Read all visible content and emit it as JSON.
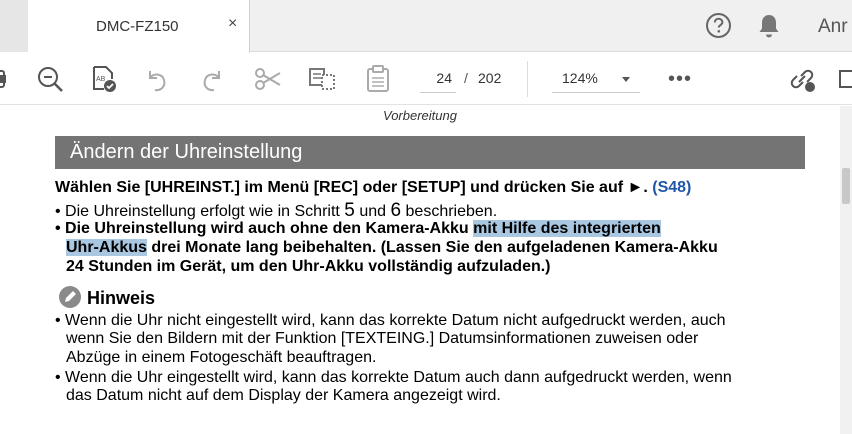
{
  "tab": {
    "title": "DMC-FZ150",
    "close": "×"
  },
  "header": {
    "user": "Anr"
  },
  "toolbar": {
    "page_current": "24",
    "page_sep": "/",
    "page_total": "202",
    "zoom": "124%",
    "more": "•••"
  },
  "doc": {
    "section_label": "Vorbereitung",
    "heading": "Ändern der Uhreinstellung",
    "intro": "Wählen Sie [UHREINST.] im Menü [REC] oder [SETUP] und drücken Sie auf ►.",
    "intro_ref": "(S48)",
    "bullets": {
      "b1_a": "Die Uhreinstellung erfolgt wie in Schritt",
      "b1_n1": "5",
      "b1_and": "und",
      "b1_n2": "6",
      "b1_b": "beschrieben.",
      "b2_a": "Die Uhreinstellung wird auch ohne den Kamera-Akku",
      "b2_hl1": "mit Hilfe des integrierten",
      "b2_hl2": "Uhr-Akkus",
      "b2_b": "drei Monate lang beibehalten. (Lassen Sie den aufgeladenen Kamera-Akku",
      "b2_c": "24 Stunden im Gerät, um den Uhr-Akku vollständig aufzuladen.)"
    },
    "hint_title": "Hinweis",
    "hints": {
      "h1_a": "Wenn die Uhr nicht eingestellt wird, kann das korrekte Datum nicht aufgedruckt werden, auch",
      "h1_b": "wenn Sie den Bildern mit der Funktion [TEXTEING.] Datumsinformationen zuweisen oder",
      "h1_c": "Abzüge in einem Fotogeschäft beauftragen.",
      "h2_a": "Wenn die Uhr eingestellt wird, kann das korrekte Datum auch dann aufgedruckt werden, wenn",
      "h2_b": "das Datum nicht auf dem Display der Kamera angezeigt wird."
    }
  },
  "colors": {
    "heading_bar": "#747474",
    "highlight": "#aac7e2",
    "link": "#1f56a8"
  }
}
